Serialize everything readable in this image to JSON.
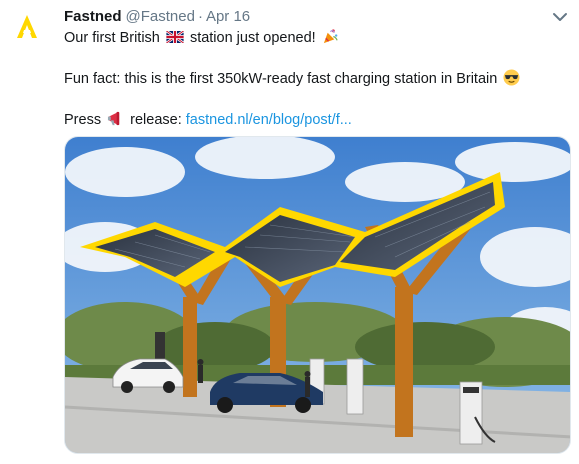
{
  "tweet": {
    "author_name": "Fastned",
    "author_handle": "@Fastned",
    "separator": "·",
    "date": "Apr 16",
    "line1_before": "Our first British",
    "line1_after": "station just opened!",
    "line2": "Fun fact: this is the first 350kW-ready fast charging station in Britain",
    "line3_before": "Press",
    "line3_mid": "release:",
    "link_text": "fastned.nl/en/blog/post/f...",
    "icons": {
      "avatar": "fastned-logo-icon",
      "caret": "chevron-down-icon",
      "flag": "uk-flag-icon",
      "party": "party-popper-icon",
      "cool": "sunglasses-face-icon",
      "megaphone": "megaphone-icon"
    }
  },
  "colors": {
    "brand_yellow": "#ffd800",
    "link_blue": "#1b95e0",
    "secondary_text": "#657786",
    "primary_text": "#14171a"
  }
}
